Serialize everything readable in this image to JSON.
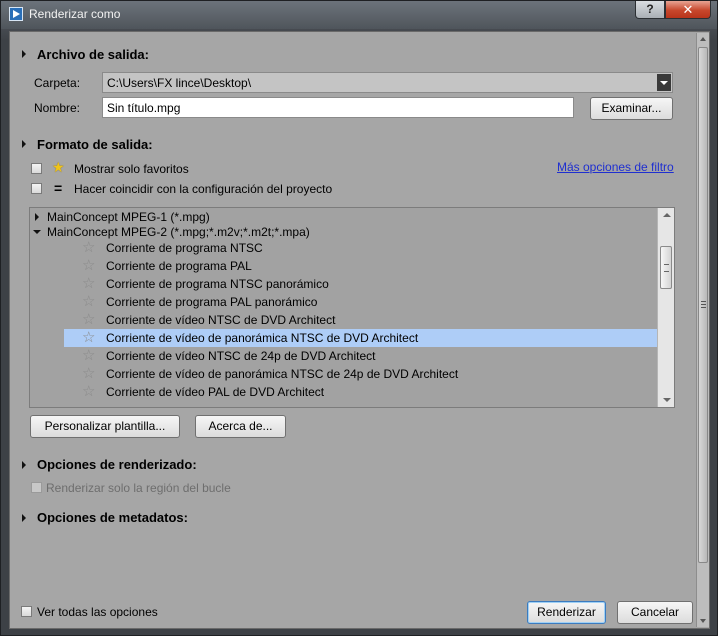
{
  "window": {
    "title": "Renderizar como",
    "help_label": "?",
    "close_label": "✕"
  },
  "output_file": {
    "title": "Archivo de salida:",
    "folder_label": "Carpeta:",
    "folder_value": "C:\\Users\\FX lince\\Desktop\\",
    "name_label": "Nombre:",
    "name_value": "Sin título.mpg",
    "browse_label": "Examinar..."
  },
  "output_format": {
    "title": "Formato de salida:",
    "show_favorites_label": "Mostrar solo favoritos",
    "match_project_label": "Hacer coincidir con la configuración del proyecto",
    "more_filters_link": "Más opciones de filtro",
    "tree": [
      {
        "label": "MainConcept MPEG-1 (*.mpg)",
        "type": "group",
        "expanded": false
      },
      {
        "label": "MainConcept MPEG-2 (*.mpg;*.m2v;*.m2t;*.mpa)",
        "type": "group",
        "expanded": true
      },
      {
        "label": "Corriente de programa NTSC",
        "type": "item"
      },
      {
        "label": "Corriente de programa PAL",
        "type": "item"
      },
      {
        "label": "Corriente de programa NTSC panorámico",
        "type": "item"
      },
      {
        "label": "Corriente de programa PAL panorámico",
        "type": "item"
      },
      {
        "label": "Corriente de vídeo NTSC de DVD Architect",
        "type": "item"
      },
      {
        "label": "Corriente de vídeo de panorámica NTSC de DVD Architect",
        "type": "item",
        "selected": true
      },
      {
        "label": "Corriente de vídeo NTSC de 24p de DVD Architect",
        "type": "item"
      },
      {
        "label": "Corriente de vídeo de panorámica NTSC de 24p de DVD Architect",
        "type": "item"
      },
      {
        "label": "Corriente de vídeo PAL de DVD Architect",
        "type": "item"
      }
    ],
    "customize_label": "Personalizar plantilla...",
    "about_label": "Acerca de..."
  },
  "render_options": {
    "title": "Opciones de renderizado:",
    "loop_region_label": "Renderizar solo la región del bucle"
  },
  "metadata_options": {
    "title": "Opciones de metadatos:"
  },
  "footer": {
    "show_all_label": "Ver todas las opciones",
    "render_label": "Renderizar",
    "cancel_label": "Cancelar"
  },
  "colors": {
    "selection": "#aecdf7",
    "link": "#1f2fd0",
    "favorite_star": "#f0c419"
  }
}
